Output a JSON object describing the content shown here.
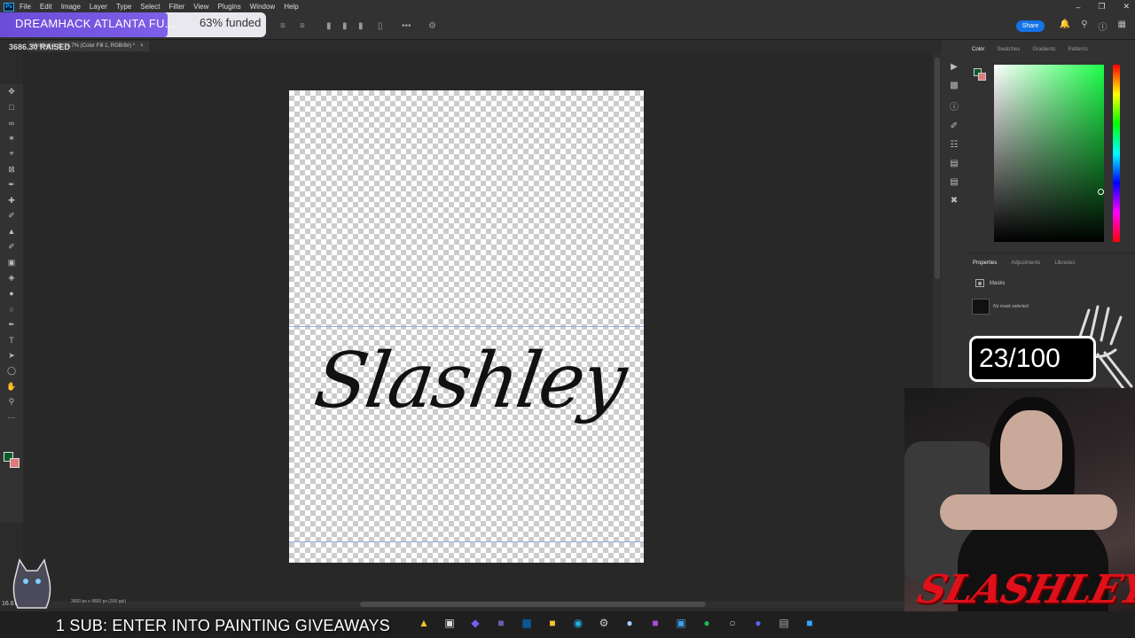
{
  "app": {
    "menu": [
      "File",
      "Edit",
      "Image",
      "Layer",
      "Type",
      "Select",
      "Filter",
      "View",
      "Plugins",
      "Window",
      "Help"
    ],
    "share_label": "Share",
    "document_tab": "Untitled-1 @ 16.7% (Color Fill 1, RGB/8#) *",
    "status_text": "3600 px x 4800 px (300 ppi)",
    "zoom_level": "16.67%"
  },
  "canvas": {
    "text": "Slashley"
  },
  "color_panel": {
    "tabs": [
      "Color",
      "Swatches",
      "Gradients",
      "Patterns"
    ],
    "foreground": "#0b5b2a",
    "background": "#e07a7a"
  },
  "properties_panel": {
    "tabs": [
      "Properties",
      "Adjustments",
      "Libraries"
    ],
    "section": "Masks",
    "note": "No mask selected"
  },
  "stream_overlay": {
    "fundraiser_title": "DREAMHACK ATLANTA FU...",
    "funded_label": "63% funded",
    "funded_fraction": 0.63,
    "raised_text": "3686.30 RAISED",
    "counter": "23/100",
    "ticker": "1 SUB: ENTER INTO PAINTING GIVEAWAYS",
    "cam_logo": "SLASHLEY"
  },
  "colors": {
    "accent": "#1473e6",
    "fund_fill": "#6b4cd8",
    "logo_red": "#e0101a"
  }
}
